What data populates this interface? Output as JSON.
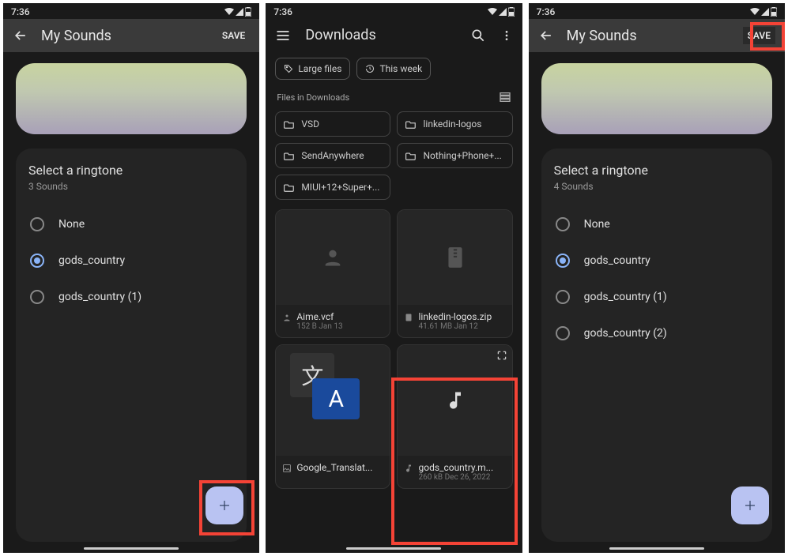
{
  "time": "7:36",
  "screen1": {
    "title": "My Sounds",
    "save": "SAVE",
    "select_header": "Select a ringtone",
    "sounds_count": "3 Sounds",
    "items": [
      {
        "label": "None",
        "selected": false
      },
      {
        "label": "gods_country",
        "selected": true
      },
      {
        "label": "gods_country (1)",
        "selected": false
      }
    ]
  },
  "screen2": {
    "title": "Downloads",
    "chip1": "Large files",
    "chip2": "This week",
    "section": "Files in Downloads",
    "folders": [
      "VSD",
      "linkedin-logos",
      "SendAnywhere",
      "Nothing+Phone+...",
      "MIUI+12+Super+..."
    ],
    "files": [
      {
        "name": "Aime.vcf",
        "detail": "152 B Jan 13",
        "icon": "person"
      },
      {
        "name": "linkedin-logos.zip",
        "detail": "41.61 MB Jan 12",
        "icon": "zip"
      },
      {
        "name": "Google_Translat...",
        "detail": "",
        "icon": "image"
      },
      {
        "name": "gods_country.m...",
        "detail": "260 kB Dec 26, 2022",
        "icon": "music"
      }
    ]
  },
  "screen3": {
    "title": "My Sounds",
    "save": "SAVE",
    "select_header": "Select a ringtone",
    "sounds_count": "4 Sounds",
    "items": [
      {
        "label": "None",
        "selected": false
      },
      {
        "label": "gods_country",
        "selected": true
      },
      {
        "label": "gods_country (1)",
        "selected": false
      },
      {
        "label": "gods_country (2)",
        "selected": false
      }
    ]
  }
}
